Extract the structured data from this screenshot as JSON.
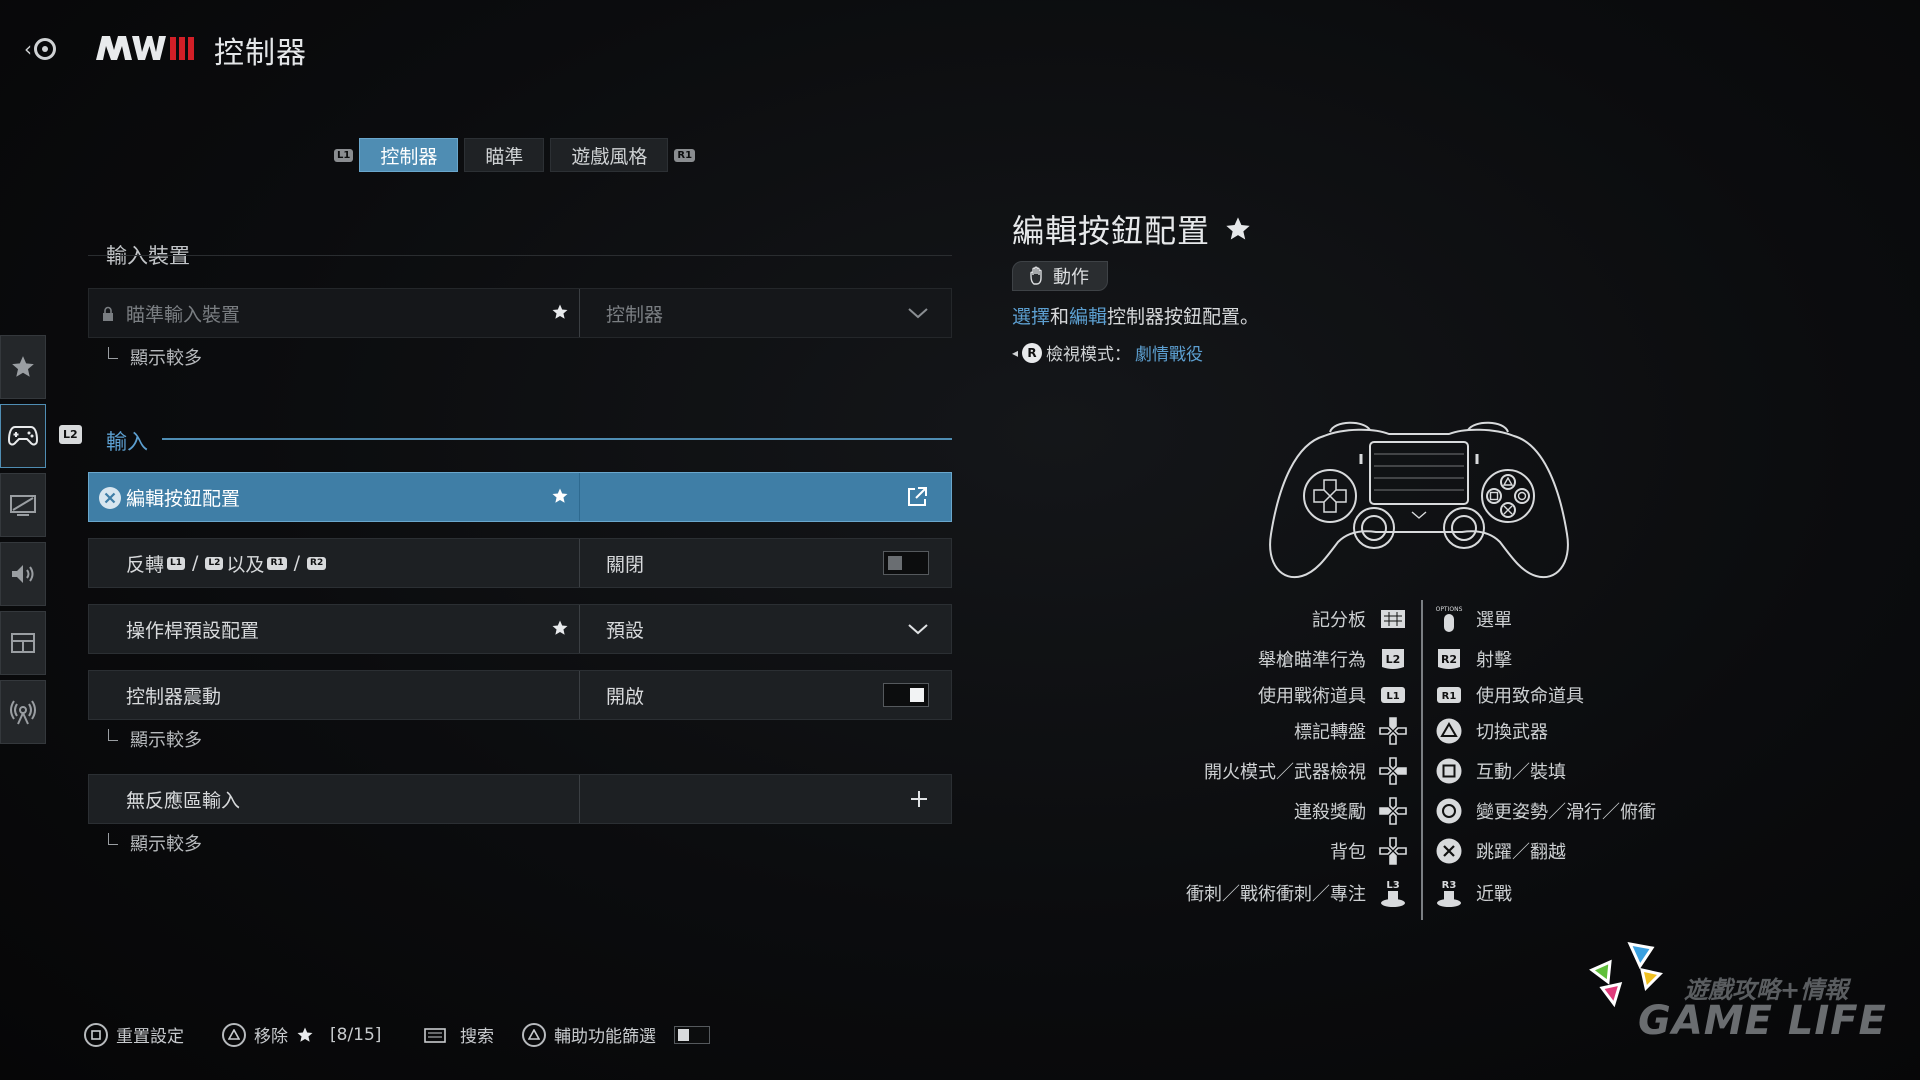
{
  "header": {
    "title": "控制器",
    "logo_text": "MWIII"
  },
  "tabs": {
    "left_bumper": "L1",
    "right_bumper": "R1",
    "items": [
      {
        "label": "控制器",
        "active": true
      },
      {
        "label": "瞄準",
        "active": false
      },
      {
        "label": "遊戲風格",
        "active": false
      }
    ]
  },
  "side_rail": {
    "items": [
      "favorites-star-icon",
      "controller-icon",
      "display-icon",
      "audio-icon",
      "interface-icon",
      "network-icon"
    ],
    "active_index": 1,
    "l2_badge": "L2"
  },
  "sections": {
    "input_device": {
      "title": "輸入裝置",
      "rows": [
        {
          "label": "瞄準輸入裝置",
          "value": "控制器",
          "locked": true,
          "starred": true
        }
      ],
      "show_more": "顯示較多"
    },
    "input": {
      "title": "輸入",
      "rows": [
        {
          "label": "編輯按鈕配置",
          "value": "",
          "starred": true,
          "selected": true
        },
        {
          "label_parts": [
            "反轉",
            "L1",
            "/",
            "L2",
            "以及",
            "R1",
            "/",
            "R2"
          ],
          "value": "關閉",
          "toggle": "off"
        },
        {
          "label": "操作桿預設配置",
          "value": "預設",
          "starred": true
        },
        {
          "label": "控制器震動",
          "value": "開啟",
          "toggle": "on"
        },
        {
          "label": "無反應區輸入",
          "value": ""
        }
      ],
      "show_more_1": "顯示較多",
      "show_more_2": "顯示較多"
    }
  },
  "detail": {
    "title": "編輯按鈕配置",
    "chip": "動作",
    "desc_select": "選擇",
    "desc_and": "和",
    "desc_edit": "編輯",
    "desc_rest": "控制器按鈕配置。",
    "view_mode_label": "檢視模式：",
    "view_mode_value": "劇情戰役",
    "view_mode_button": "R"
  },
  "mapping": {
    "left": [
      {
        "label": "記分板",
        "button": "touchpad"
      },
      {
        "label": "舉槍瞄準行為",
        "button": "L2"
      },
      {
        "label": "使用戰術道具",
        "button": "L1"
      },
      {
        "label": "標記轉盤",
        "button": "dpad-up"
      },
      {
        "label": "開火模式／武器檢視",
        "button": "dpad-right"
      },
      {
        "label": "連殺獎勵",
        "button": "dpad-left"
      },
      {
        "label": "背包",
        "button": "dpad-down"
      },
      {
        "label": "衝刺／戰術衝刺／專注",
        "button": "L3"
      }
    ],
    "right": [
      {
        "label": "選單",
        "button": "options"
      },
      {
        "label": "射擊",
        "button": "R2"
      },
      {
        "label": "使用致命道具",
        "button": "R1"
      },
      {
        "label": "切換武器",
        "button": "triangle"
      },
      {
        "label": "互動／裝填",
        "button": "square"
      },
      {
        "label": "變更姿勢／滑行／俯衝",
        "button": "circle"
      },
      {
        "label": "跳躍／翻越",
        "button": "cross"
      },
      {
        "label": "近戰",
        "button": "R3"
      }
    ]
  },
  "footer": {
    "reset": "重置設定",
    "remove": "移除",
    "remove_count": "[8/15]",
    "search": "搜索",
    "accessibility": "輔助功能篩選"
  },
  "watermark": {
    "line1": "遊戲攻略+情報",
    "line2": "GAME LIFE"
  },
  "colors": {
    "accent": "#4f8db3",
    "highlight_text": "#5c9fd0"
  }
}
